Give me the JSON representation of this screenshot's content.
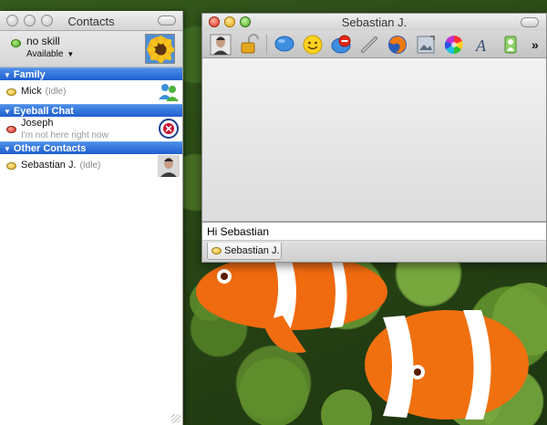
{
  "contacts_window": {
    "title": "Contacts",
    "account": {
      "name": "no skill",
      "status": "Available"
    },
    "groups": [
      {
        "name": "Family",
        "contacts": [
          {
            "name": "Mick",
            "idle": "(Idle)",
            "status_color": "#e8b21c"
          }
        ]
      },
      {
        "name": "Eyeball Chat",
        "contacts": [
          {
            "name": "Joseph",
            "away_message": "I'm not here right now",
            "status_color": "#d3291b"
          }
        ]
      },
      {
        "name": "Other Contacts",
        "contacts": [
          {
            "name": "Sebastian J.",
            "idle": "(Idle)",
            "status_color": "#e8b21c"
          }
        ]
      }
    ]
  },
  "chat_window": {
    "title": "Sebastian J.",
    "toolbar": [
      "buddy-photo-icon",
      "lock-icon",
      "speech-bubble-icon",
      "smiley-icon",
      "block-icon",
      "link-icon",
      "firefox-icon",
      "image-icon",
      "color-wheel-icon",
      "font-icon",
      "file-transfer-icon"
    ],
    "message_input_value": "Hi Sebastian",
    "tab_label": "Sebastian J."
  },
  "colors": {
    "group_header": "#1f5fcf",
    "available_green": "#3f9e12",
    "idle_yellow": "#e8b21c",
    "away_red": "#d3291b"
  }
}
